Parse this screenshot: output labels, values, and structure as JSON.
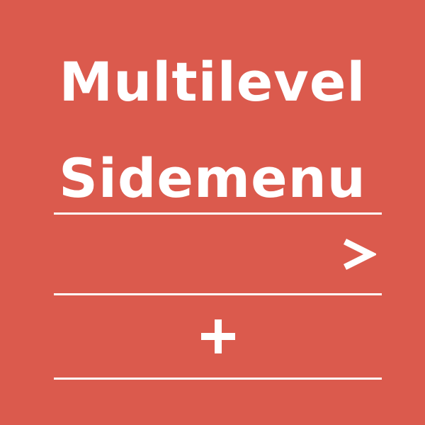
{
  "title": {
    "line1": "Multilevel",
    "line2": "Sidemenu"
  },
  "menu": {
    "rows": [
      {
        "icon": "chevron-right-icon"
      },
      {
        "icon": "plus-icon"
      }
    ]
  },
  "colors": {
    "background": "#db5a4d",
    "foreground": "#ffffff"
  }
}
